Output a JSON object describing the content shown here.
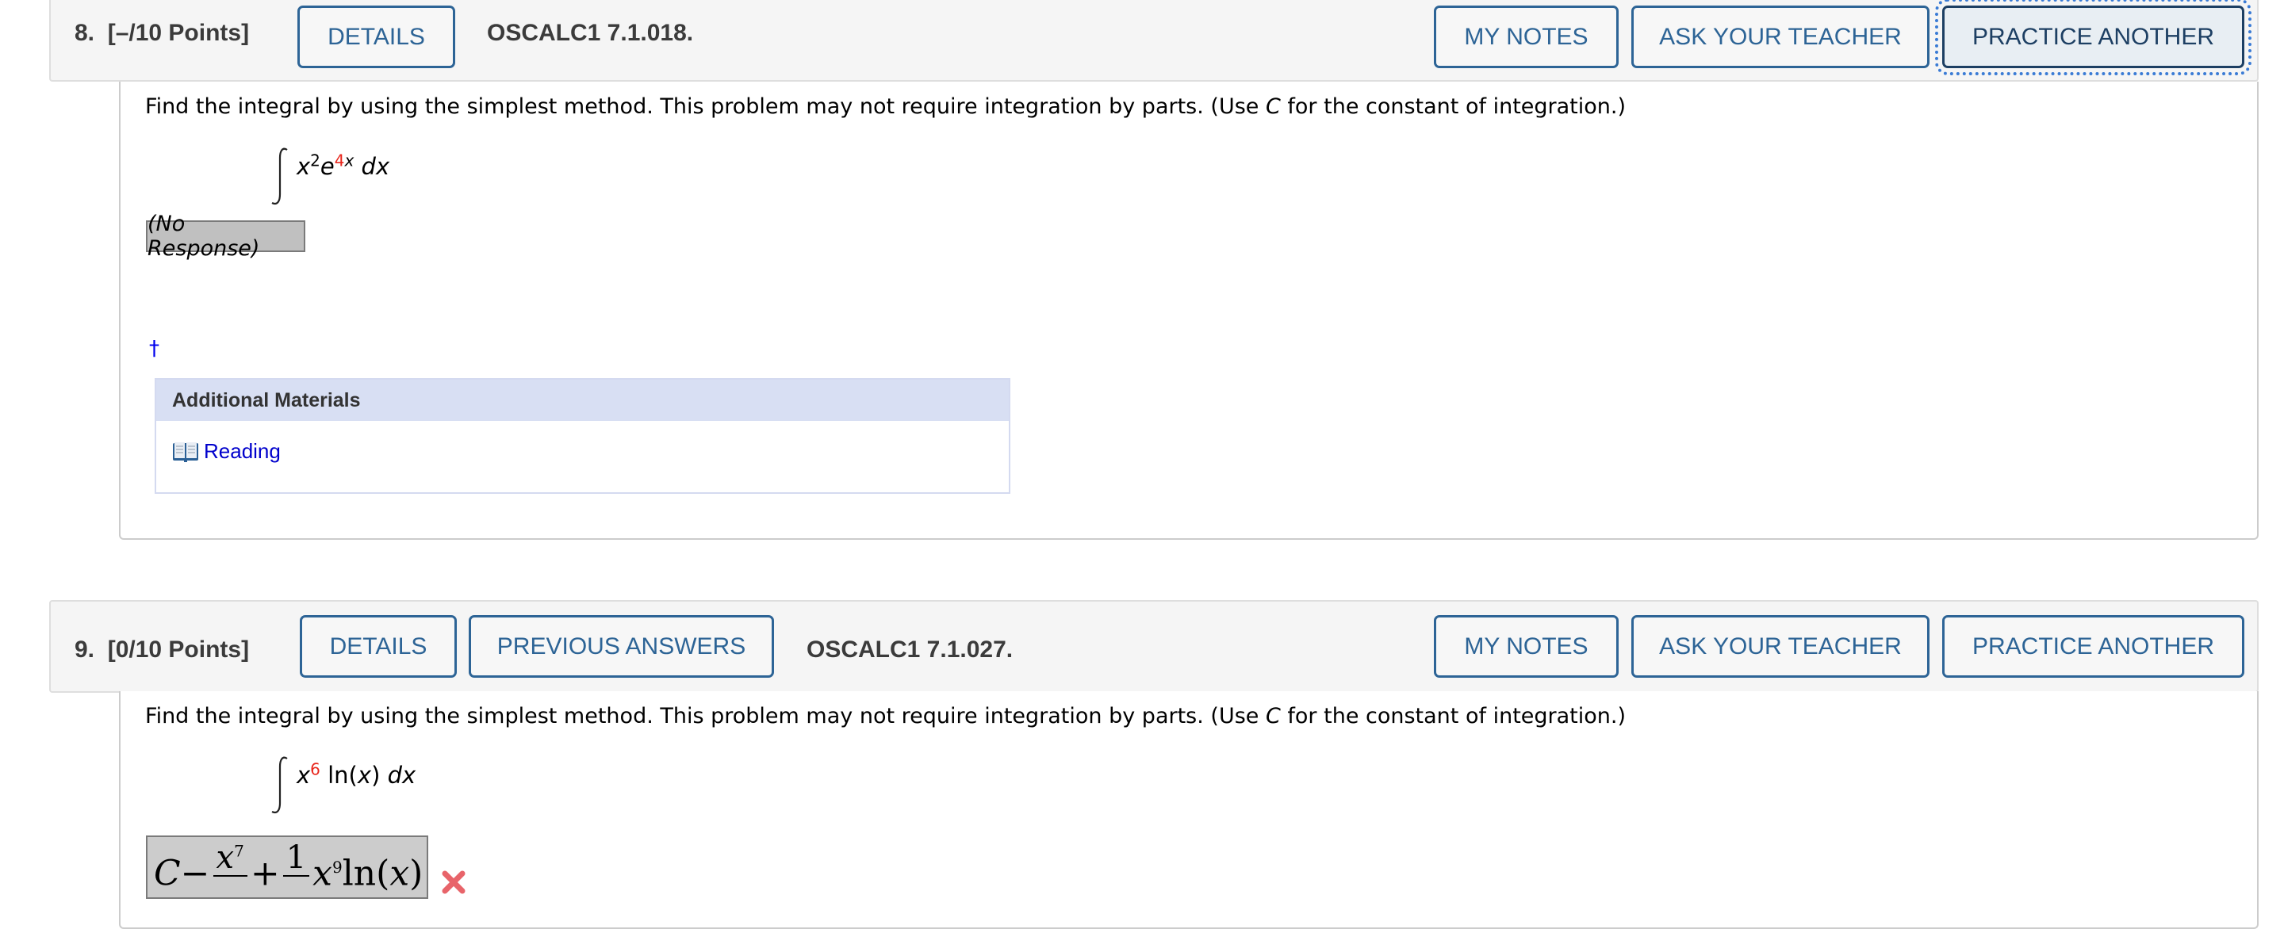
{
  "questions": [
    {
      "number_label": "8.",
      "points_label": "[–/10 Points]",
      "buttons": {
        "details": "DETAILS",
        "my_notes": "MY NOTES",
        "ask_teacher": "ASK YOUR TEACHER",
        "practice_another": "PRACTICE ANOTHER"
      },
      "code": "OSCALC1 7.1.018.",
      "prompt_before_c": "Find the integral by using the simplest method. This problem may not require integration by parts. (Use ",
      "prompt_c": "C",
      "prompt_after_c": " for the constant of integration.)",
      "integrand": {
        "base1": "x",
        "exp1": "2",
        "base2": "e",
        "exp2_red": "4",
        "exp2_rest": "x",
        "differential": "dx"
      },
      "response": "(No Response)",
      "footnote_marker": "†",
      "additional_materials": {
        "title": "Additional Materials",
        "items": [
          {
            "label": "Reading",
            "icon": "book-icon"
          }
        ]
      }
    },
    {
      "number_label": "9.",
      "points_label": "[0/10 Points]",
      "buttons": {
        "details": "DETAILS",
        "previous_answers": "PREVIOUS ANSWERS",
        "my_notes": "MY NOTES",
        "ask_teacher": "ASK YOUR TEACHER",
        "practice_another": "PRACTICE ANOTHER"
      },
      "code": "OSCALC1 7.1.027.",
      "prompt_before_c": "Find the integral by using the simplest method. This problem may not require integration by parts. (Use ",
      "prompt_c": "C",
      "prompt_after_c": " for the constant of integration.)",
      "integrand": {
        "base1": "x",
        "exp1_red": "6",
        "func": "ln(",
        "arg": "x",
        "close": ")",
        "differential": "dx"
      },
      "answer": {
        "c": "C",
        "minus": "−",
        "frac1_num_base": "x",
        "frac1_num_exp": "7",
        "plus": "+",
        "frac2_num": "1",
        "term_base": "x",
        "term_exp": "9",
        "term_func": "ln(",
        "term_arg": "x",
        "term_close": ")",
        "status": "incorrect",
        "status_icon": "x-mark-icon"
      }
    }
  ],
  "colors": {
    "button_blue": "#2d6496",
    "focused_button": "#1d3f63",
    "focus_outline": "#3a7bd5",
    "red_value": "#e8261c",
    "link_blue": "#0000cc",
    "materials_header": "#d8dff3"
  }
}
